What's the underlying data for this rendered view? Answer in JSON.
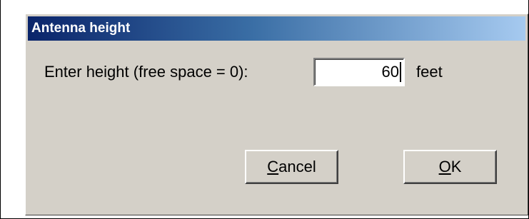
{
  "dialog": {
    "title": "Antenna height",
    "prompt_label": "Enter height (free space = 0):",
    "height_value": "60",
    "unit_label": "feet",
    "cancel_button": {
      "accelerator": "C",
      "rest": "ancel"
    },
    "ok_button": {
      "accelerator": "O",
      "rest": "K"
    }
  },
  "colors": {
    "dialog_face": "#d4d0c8",
    "title_gradient_start": "#0a246a",
    "title_gradient_end": "#a6caf0",
    "title_text": "#ffffff"
  }
}
